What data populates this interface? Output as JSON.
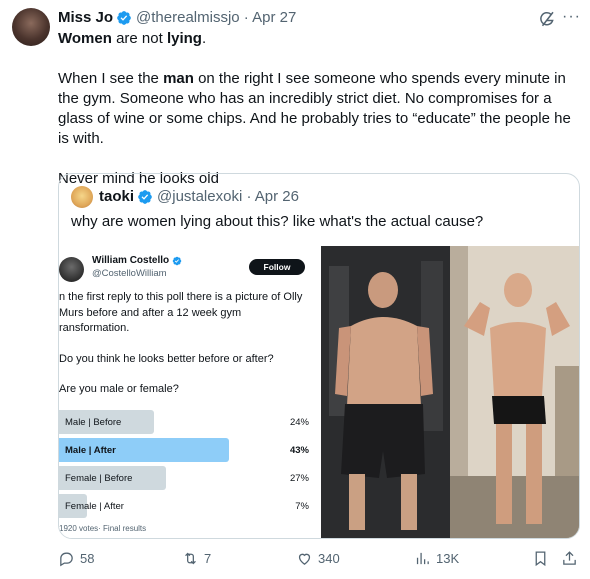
{
  "tweet": {
    "author_name": "Miss Jo",
    "handle_date": "@therealmissjo · Apr 27",
    "line1_bold1": "Women",
    "line1_mid": " are not ",
    "line1_bold2": "lying",
    "line1_end": ".",
    "p2_start": "When I see the ",
    "p2_bold": "man",
    "p2_end": " on the right I see someone who spends every minute in the gym. Someone who has an incredibly strict diet. No compromises for a glass of wine or some chips. And he probably tries to “educate” the people he is with.",
    "p3": "Never mind he looks old"
  },
  "quote": {
    "author_name": "taoki",
    "handle_date": "@justalexoki · Apr 26",
    "text": "why are women lying about this? like what's the actual cause?"
  },
  "poll_image": {
    "name": "William Costello",
    "handle": "@CostelloWilliam",
    "follow_label": "Follow",
    "para1": "n the first reply to this poll there is a picture of Olly Murs before and after a 12 week gym ransformation.",
    "para2": "Do you think he looks better before or after?",
    "para3": "Are you male or female?",
    "options": [
      {
        "label": "Male | Before",
        "percent": "24%",
        "fraction": 0.24
      },
      {
        "label": "Male | After",
        "percent": "43%",
        "fraction": 0.43
      },
      {
        "label": "Female | Before",
        "percent": "27%",
        "fraction": 0.27
      },
      {
        "label": "Female | After",
        "percent": "7%",
        "fraction": 0.07
      }
    ],
    "votes": "1920 votes· Final results"
  },
  "actions": {
    "replies": "58",
    "reposts": "7",
    "likes": "340",
    "views": "13K"
  },
  "colors": {
    "verified": "#1d9bf0",
    "poll_winner": "#8ecdf8",
    "poll_bar": "#cfd9de"
  }
}
